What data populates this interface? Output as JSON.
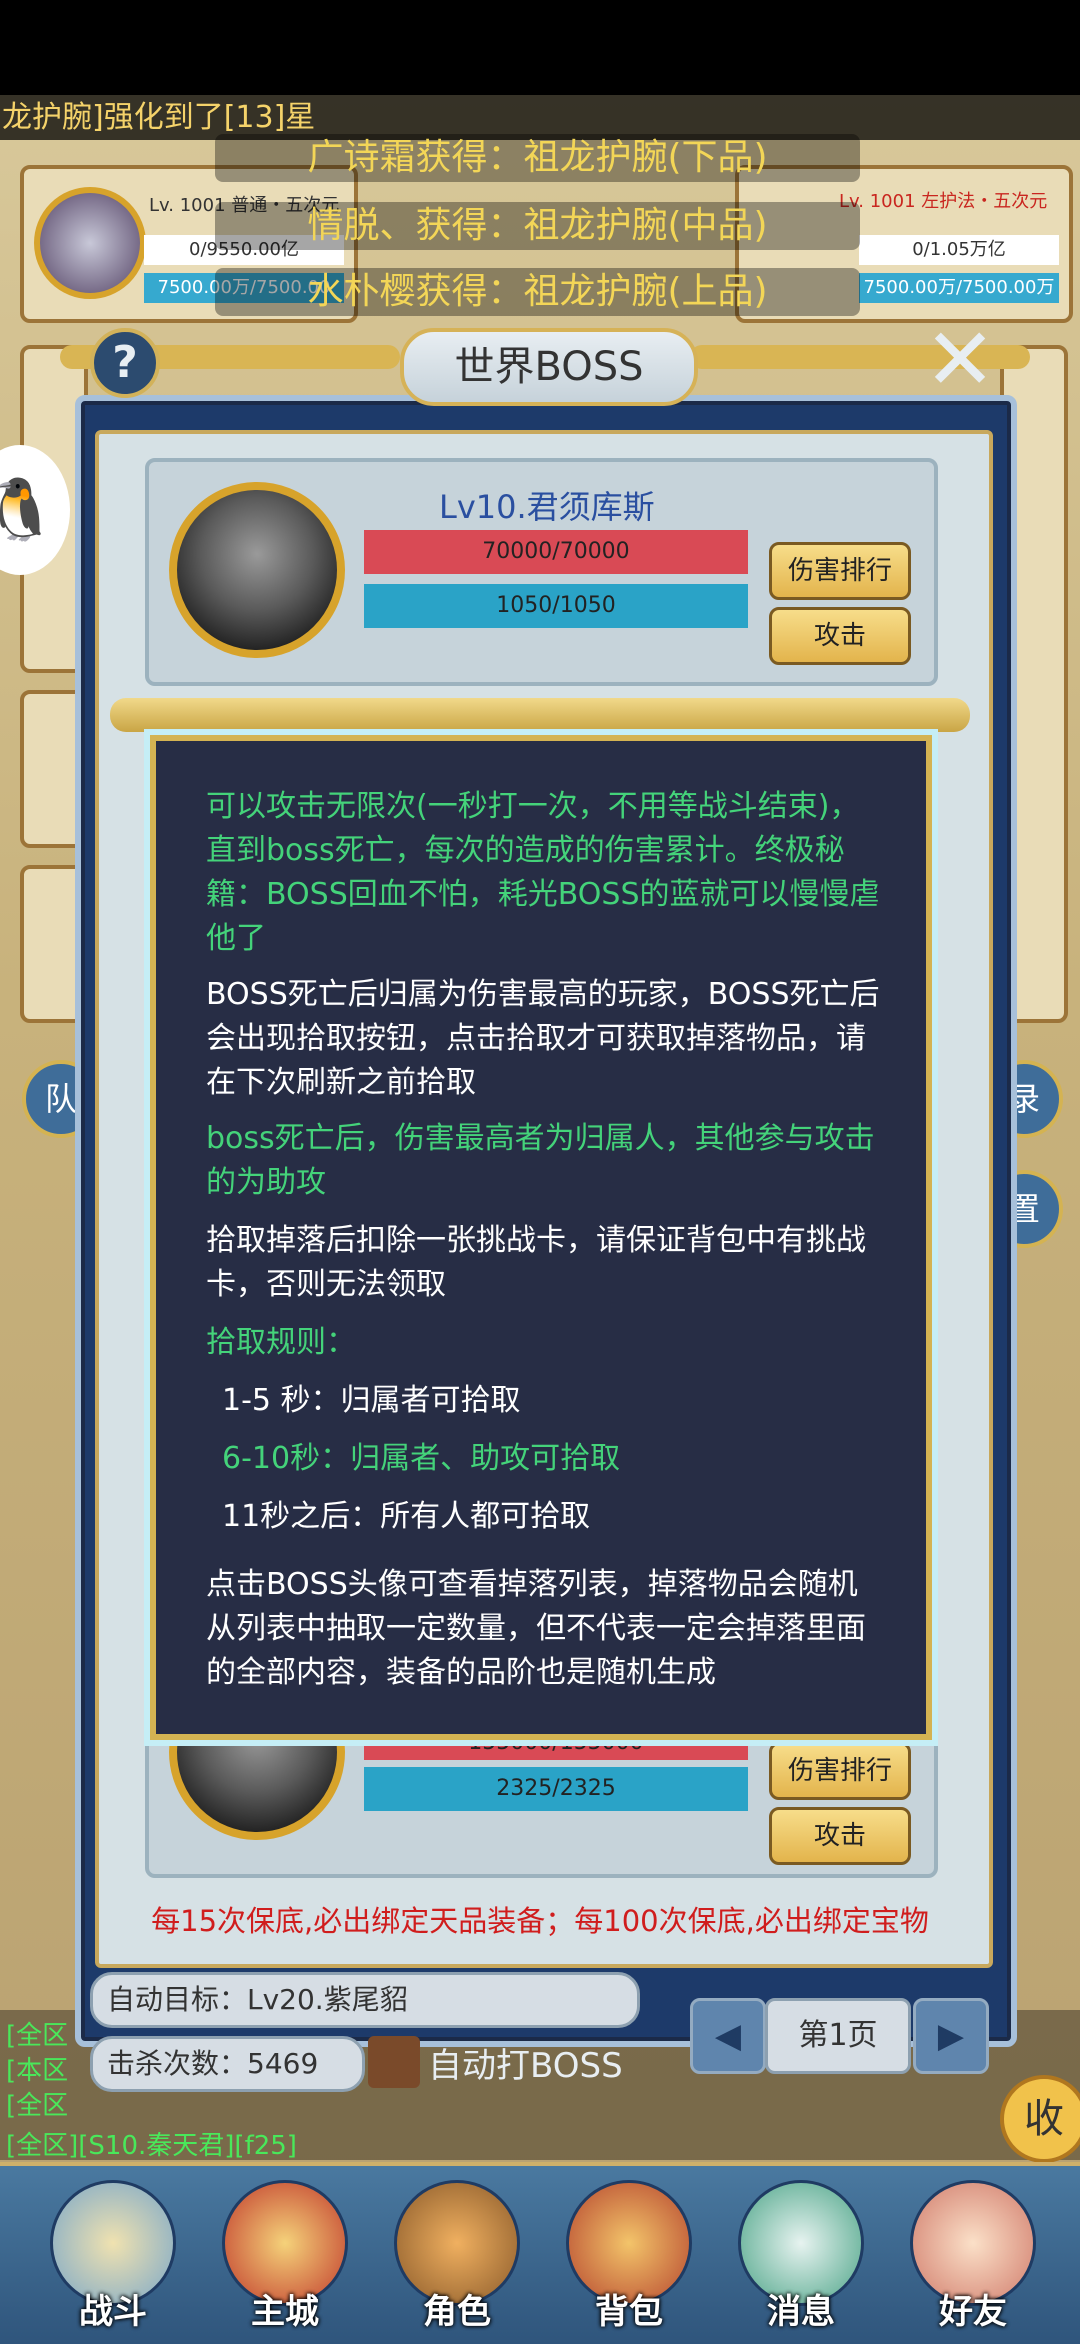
{
  "ticker": "龙护腕]强化到了[13]星",
  "background": {
    "broadcasts": [
      "广诗霜获得：祖龙护腕(下品)",
      "情脱、获得：祖龙护腕(中品)",
      "水朴樱获得：祖龙护腕(上品)"
    ],
    "cards": [
      {
        "title": "Lv. 1001 普通・五次元",
        "hp": "0/9550.00亿",
        "mp": "7500.00万/7500.00"
      },
      {
        "title": "Lv. 1001 左护法・五次元",
        "hp": "0/1.05万亿",
        "mp": "7500.00万/7500.00万"
      }
    ],
    "chat": [
      "[全区",
      "[本区",
      "[全区",
      "[全区][S10.秦天君][f25]"
    ],
    "side_tab_left": "队",
    "side_tab_right_1": "录",
    "side_tab_right_2": "置",
    "collect": "收"
  },
  "dialog": {
    "title": "世界BOSS",
    "help": "?",
    "close": "✕",
    "boss1": {
      "name": "Lv10.君须库斯",
      "hp": "70000/70000",
      "mp": "1050/1050",
      "rank": "伤害排行",
      "attack": "攻击"
    },
    "boss2": {
      "hp": "155000/155000",
      "mp": "2325/2325",
      "rank": "伤害排行",
      "attack": "攻击"
    },
    "note": "每15次保底,必出绑定天品装备；每100次保底,必出绑定宝物",
    "auto_target": "自动目标：Lv20.紫尾貂",
    "kills": "击杀次数：5469",
    "auto_boss": "自动打BOSS",
    "page": "第1页",
    "prev": "◀",
    "next": "▶"
  },
  "info": {
    "p1": "可以攻击无限次(一秒打一次，不用等战斗结束)，直到boss死亡，每次的造成的伤害累计。终极秘籍：BOSS回血不怕，耗光BOSS的蓝就可以慢慢虐他了",
    "p2": "BOSS死亡后归属为伤害最高的玩家，BOSS死亡后会出现拾取按钮，点击拾取才可获取掉落物品，请在下次刷新之前拾取",
    "p3": "boss死亡后，伤害最高者为归属人，其他参与攻击的为助攻",
    "p4": "拾取掉落后扣除一张挑战卡，请保证背包中有挑战卡，否则无法领取",
    "p5": "拾取规则：",
    "r1": "1-5 秒：归属者可拾取",
    "r2": "6-10秒：归属者、助攻可拾取",
    "r3": "11秒之后：所有人都可拾取",
    "p6": "点击BOSS头像可查看掉落列表，掉落物品会随机从列表中抽取一定数量，但不代表一定会掉落里面的全部内容，装备的品阶也是随机生成"
  },
  "nav": [
    {
      "label": "战斗",
      "icon": "battle-icon"
    },
    {
      "label": "主城",
      "icon": "city-icon"
    },
    {
      "label": "角色",
      "icon": "character-icon"
    },
    {
      "label": "背包",
      "icon": "bag-icon"
    },
    {
      "label": "消息",
      "icon": "message-icon"
    },
    {
      "label": "好友",
      "icon": "friends-icon"
    }
  ],
  "colors": {
    "accent_gold": "#d4b352",
    "popup_bg": "#272d45",
    "green_text": "#44d37a",
    "hp_red": "#d94a55",
    "mp_cyan": "#2aa3c7"
  }
}
